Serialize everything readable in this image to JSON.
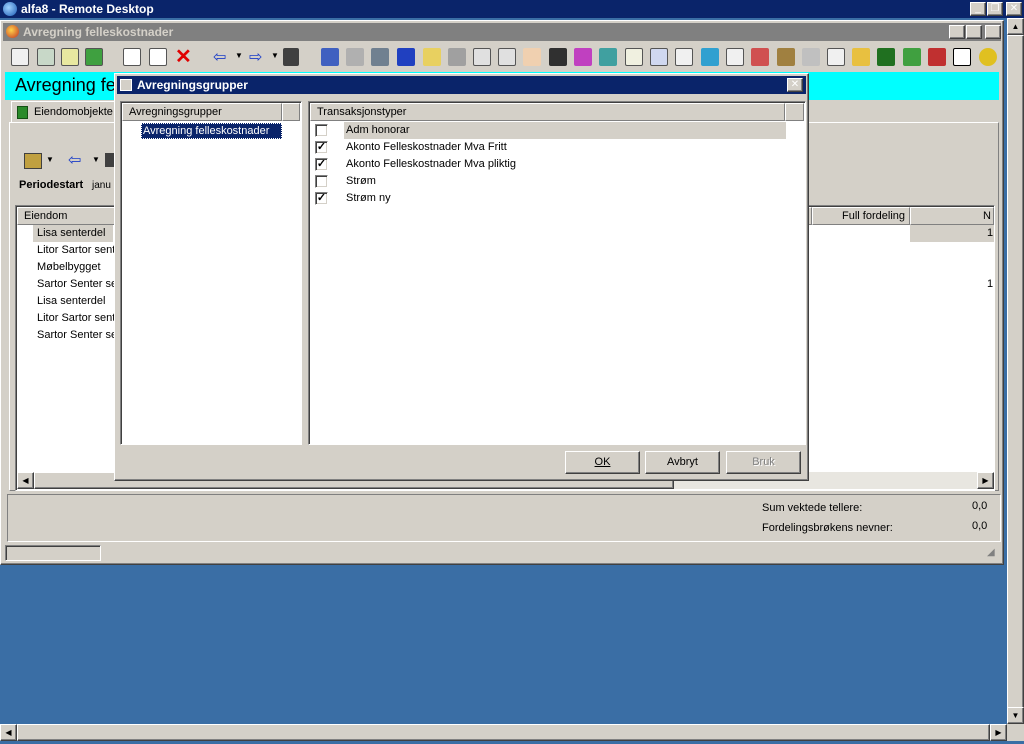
{
  "rd": {
    "title": "alfa8 - Remote Desktop"
  },
  "main": {
    "title": "Avregning felleskostnader",
    "banner": "Avregning fe",
    "tab_label": "Eiendomobjekte",
    "period_label": "Periodestart",
    "period_value": "janu",
    "columns": {
      "eiendom": "Eiendom",
      "full_fordeling": "Full fordeling",
      "n": "N"
    },
    "rows": [
      {
        "name": "Lisa senterdel",
        "n": "1"
      },
      {
        "name": "Litor Sartor sente",
        "n": ""
      },
      {
        "name": "Møbelbygget",
        "n": ""
      },
      {
        "name": "Sartor Senter ser",
        "n": "1"
      },
      {
        "name": "Lisa senterdel",
        "n": ""
      },
      {
        "name": "Litor Sartor sente",
        "n": ""
      },
      {
        "name": "Sartor Senter ser",
        "n": ""
      }
    ],
    "sum_vektede_label": "Sum vektede tellere:",
    "sum_vektede_value": "0,0",
    "nevner_label": "Fordelingsbrøkens nevner:",
    "nevner_value": "0,0"
  },
  "dialog": {
    "title": "Avregningsgrupper",
    "groups_header": "Avregningsgrupper",
    "groups": [
      "Avregning felleskostnader"
    ],
    "types_header": "Transaksjonstyper",
    "types": [
      {
        "label": "Adm honorar",
        "checked": false
      },
      {
        "label": "Akonto Felleskostnader Mva Fritt",
        "checked": true
      },
      {
        "label": "Akonto Felleskostnader Mva pliktig",
        "checked": true
      },
      {
        "label": "Strøm",
        "checked": false
      },
      {
        "label": "Strøm ny",
        "checked": true
      }
    ],
    "ok": "OK",
    "cancel": "Avbryt",
    "apply": "Bruk"
  },
  "colors": {
    "titlebar": "#0a246a",
    "banner": "#00ffff",
    "desktop": "#3a6ea5",
    "face": "#d4d0c8"
  }
}
